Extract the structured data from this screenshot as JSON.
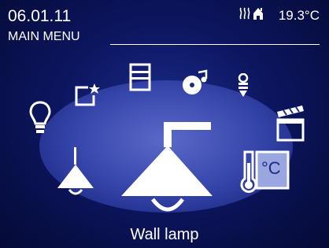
{
  "header": {
    "date": "06.01.11",
    "menu_title": "MAIN MENU",
    "temperature": "19.3°C"
  },
  "icons": [
    "lightbulb-icon",
    "star-frame-icon",
    "blinds-icon",
    "music-icon",
    "plug-icon",
    "clapperboard-icon",
    "hanging-lamp-icon",
    "wall-lamp-icon",
    "thermometer-celsius-icon",
    "heating-icon",
    "house-icon"
  ],
  "selected_label": "Wall lamp",
  "colors": {
    "background": "#0c1660",
    "ellipse": "#3746ab",
    "icon": "#ffffff"
  }
}
